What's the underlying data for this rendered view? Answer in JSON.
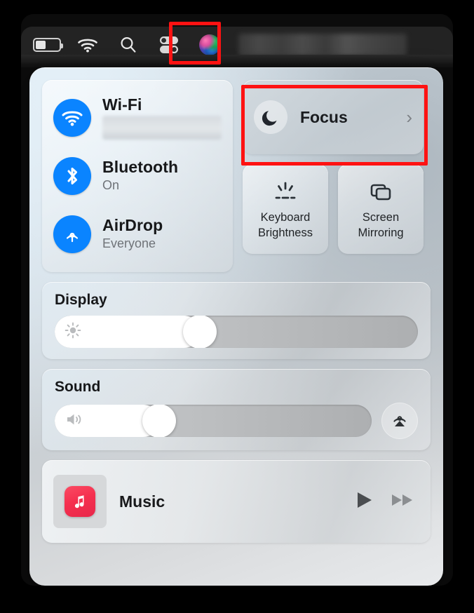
{
  "menubar": {
    "items": [
      {
        "name": "battery",
        "icon": "battery-icon",
        "label": "Battery"
      },
      {
        "name": "wifi",
        "icon": "wifi-icon",
        "label": "Wi-Fi"
      },
      {
        "name": "spotlight",
        "icon": "search-icon",
        "label": "Spotlight Search"
      },
      {
        "name": "control-center",
        "icon": "control-center-icon",
        "label": "Control Center"
      },
      {
        "name": "siri",
        "icon": "siri-icon",
        "label": "Siri"
      },
      {
        "name": "clock",
        "icon": "clock-redacted",
        "label": ""
      }
    ]
  },
  "annotations": {
    "color": "#ff1212",
    "boxes": [
      {
        "target": "control-center-menubar-icon"
      },
      {
        "target": "focus-tile"
      }
    ]
  },
  "control_center": {
    "connectivity": [
      {
        "title": "Wi-Fi",
        "status": "",
        "status_redacted": true,
        "icon": "wifi-icon",
        "color": "#0a84ff"
      },
      {
        "title": "Bluetooth",
        "status": "On",
        "status_redacted": false,
        "icon": "bluetooth-icon",
        "color": "#0a84ff"
      },
      {
        "title": "AirDrop",
        "status": "Everyone",
        "status_redacted": false,
        "icon": "airdrop-icon",
        "color": "#0a84ff"
      }
    ],
    "focus": {
      "label": "Focus",
      "icon": "moon-icon",
      "chevron": "›"
    },
    "tiles": [
      {
        "label": "Keyboard\nBrightness",
        "line1": "Keyboard",
        "line2": "Brightness",
        "icon": "keyboard-brightness-icon"
      },
      {
        "label": "Screen\nMirroring",
        "line1": "Screen",
        "line2": "Mirroring",
        "icon": "screen-mirroring-icon"
      }
    ],
    "display": {
      "title": "Display",
      "slider_value": 40,
      "icon": "brightness-icon"
    },
    "sound": {
      "title": "Sound",
      "slider_value": 33,
      "icon": "volume-icon",
      "airplay_icon": "airplay-audio-icon"
    },
    "music": {
      "app_name": "Music",
      "app_icon": "apple-music-icon",
      "play_icon": "play-icon",
      "forward_icon": "fast-forward-icon"
    }
  }
}
